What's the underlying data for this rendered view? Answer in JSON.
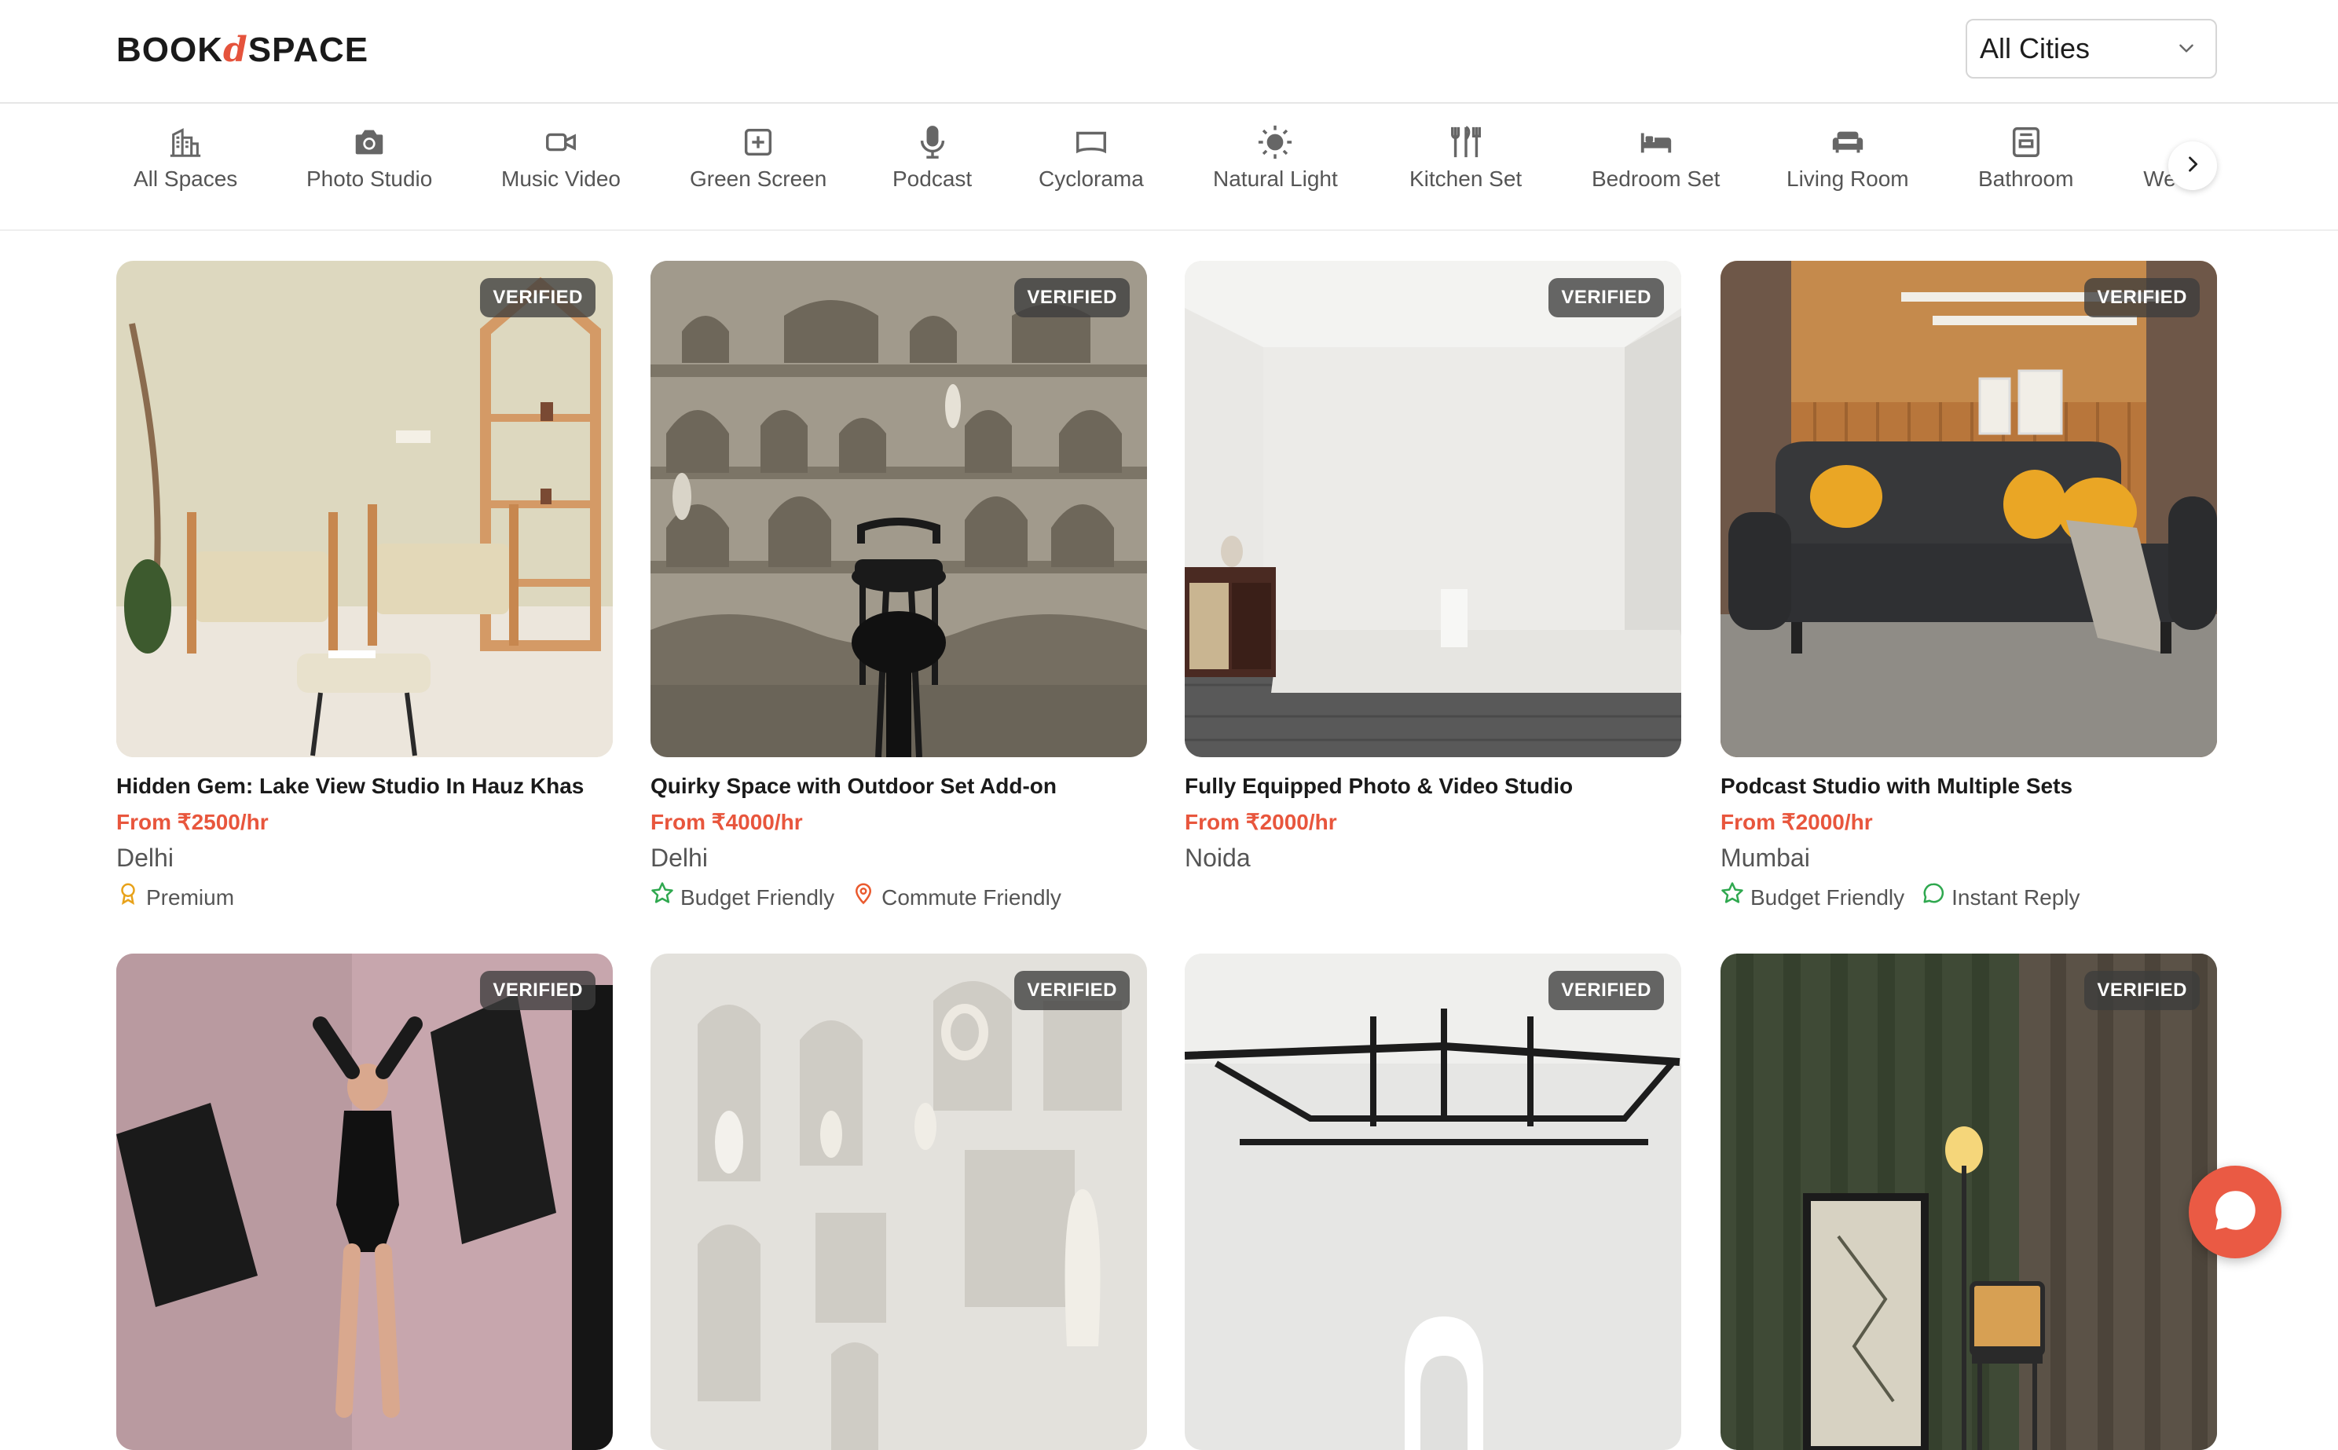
{
  "brand": {
    "logo_left": "BOOK",
    "logo_accent": "d",
    "logo_right": "SPACE"
  },
  "city_select": {
    "value": "All Cities",
    "icon": "chevron-down-icon"
  },
  "categories": [
    {
      "label": "All Spaces",
      "icon": "building-icon"
    },
    {
      "label": "Photo Studio",
      "icon": "camera-icon"
    },
    {
      "label": "Music Video",
      "icon": "video-camera-icon"
    },
    {
      "label": "Green Screen",
      "icon": "green-screen-icon"
    },
    {
      "label": "Podcast",
      "icon": "microphone-icon"
    },
    {
      "label": "Cyclorama",
      "icon": "cyclorama-icon"
    },
    {
      "label": "Natural Light",
      "icon": "sun-icon"
    },
    {
      "label": "Kitchen Set",
      "icon": "utensils-icon"
    },
    {
      "label": "Bedroom Set",
      "icon": "bed-icon"
    },
    {
      "label": "Living Room",
      "icon": "sofa-icon"
    },
    {
      "label": "Bathroom",
      "icon": "bathroom-icon"
    },
    {
      "label": "We",
      "icon": ""
    }
  ],
  "badge_label": "VERIFIED",
  "listings": [
    {
      "title": "Hidden Gem: Lake View Studio In Hauz Khas",
      "price": "From ₹2500/hr",
      "city": "Delhi",
      "tags": [
        {
          "label": "Premium",
          "icon": "award-icon",
          "color": "#e8a21a"
        }
      ]
    },
    {
      "title": "Quirky Space with Outdoor Set Add-on",
      "price": "From ₹4000/hr",
      "city": "Delhi",
      "tags": [
        {
          "label": "Budget Friendly",
          "icon": "star-icon",
          "color": "#2fa84f"
        },
        {
          "label": "Commute Friendly",
          "icon": "map-pin-icon",
          "color": "#ea5a2e"
        }
      ]
    },
    {
      "title": "Fully Equipped Photo & Video Studio",
      "price": "From ₹2000/hr",
      "city": "Noida",
      "tags": []
    },
    {
      "title": "Podcast Studio with Multiple Sets",
      "price": "From ₹2000/hr",
      "city": "Mumbai",
      "tags": [
        {
          "label": "Budget Friendly",
          "icon": "star-icon",
          "color": "#2fa84f"
        },
        {
          "label": "Instant Reply",
          "icon": "chat-bubble-icon",
          "color": "#2fa84f"
        }
      ]
    }
  ],
  "colors": {
    "accent": "#e8563d",
    "chat_button": "#ea5a44"
  }
}
